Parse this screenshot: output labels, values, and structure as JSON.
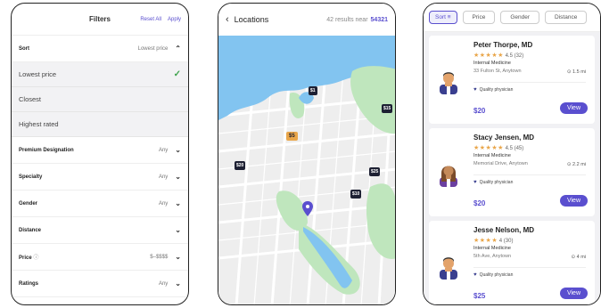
{
  "filters": {
    "title": "Filters",
    "reset_label": "Reset All",
    "apply_label": "Apply",
    "sort": {
      "label": "Sort",
      "value": "Lowest price"
    },
    "sort_options": [
      {
        "label": "Lowest price",
        "selected": true
      },
      {
        "label": "Closest",
        "selected": false
      },
      {
        "label": "Highest rated",
        "selected": false
      }
    ],
    "rows": [
      {
        "label": "Premium Designation",
        "value": "Any"
      },
      {
        "label": "Specialty",
        "value": "Any"
      },
      {
        "label": "Gender",
        "value": "Any"
      },
      {
        "label": "Distance",
        "value": ""
      },
      {
        "label": "Price",
        "value": "$–$$$$"
      },
      {
        "label": "Ratings",
        "value": "Any"
      }
    ]
  },
  "map": {
    "title": "Locations",
    "count_text": "42 results near",
    "zip": "54321",
    "pins": [
      {
        "label": "$1"
      },
      {
        "label": "$15"
      },
      {
        "label": "$5"
      },
      {
        "label": "$20"
      },
      {
        "label": "$25"
      },
      {
        "label": "$10"
      }
    ]
  },
  "results": {
    "chips": [
      {
        "label": "Sort"
      },
      {
        "label": "Price"
      },
      {
        "label": "Gender"
      },
      {
        "label": "Distance"
      }
    ],
    "cards": [
      {
        "name": "Peter Thorpe, MD",
        "stars": "★★★★★",
        "rating": "4.5 (32)",
        "specialty": "Internal Medicine",
        "address": "33 Fulton St, Anytown",
        "distance": "1.5 mi",
        "quality": "Quality physician",
        "price": "$20",
        "view": "View"
      },
      {
        "name": "Stacy Jensen, MD",
        "stars": "★★★★★",
        "rating": "4.5 (45)",
        "specialty": "Internal Medicine",
        "address": "Memorial Drive, Anytown",
        "distance": "2.2 mi",
        "quality": "Quality physician",
        "price": "$20",
        "view": "View"
      },
      {
        "name": "Jesse Nelson, MD",
        "stars": "★★★★",
        "rating": "4 (30)",
        "specialty": "Internal Medicine",
        "address": "5th Ave, Anytown",
        "distance": "4 mi",
        "quality": "Quality physician",
        "price": "$25",
        "view": "View"
      }
    ]
  },
  "colors": {
    "accent": "#5a4fcf",
    "star": "#e9a64a",
    "check": "#3fa34d",
    "water": "#82c4f0",
    "park": "#bfe6bd"
  }
}
